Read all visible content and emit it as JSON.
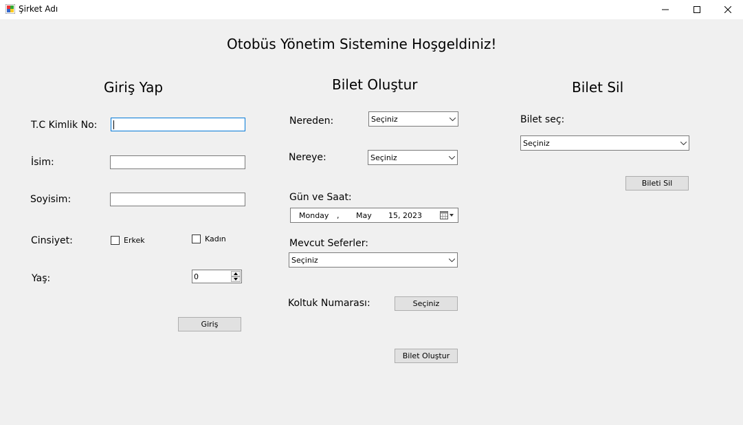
{
  "window": {
    "title": "Şirket Adı",
    "icons": [
      "app-icon",
      "minimize-icon",
      "maximize-icon",
      "close-icon"
    ]
  },
  "main_title": "Otobüs Yönetim Sistemine Hoşgeldiniz!",
  "login": {
    "heading": "Giriş Yap",
    "tc_label": "T.C Kimlik No:",
    "tc_value": "",
    "name_label": "İsim:",
    "name_value": "",
    "surname_label": "Soyisim:",
    "surname_value": "",
    "gender_label": "Cinsiyet:",
    "male_label": "Erkek",
    "female_label": "Kadın",
    "age_label": "Yaş:",
    "age_value": "0",
    "login_button": "Giriş"
  },
  "create_ticket": {
    "heading": "Bilet Oluştur",
    "from_label": "Nereden:",
    "from_value": "Seçiniz",
    "to_label": "Nereye:",
    "to_value": "Seçiniz",
    "datetime_label": "Gün ve Saat:",
    "date_weekday": "Monday",
    "date_sep": ",",
    "date_month": "May",
    "date_day_year": "15, 2023",
    "trips_label": "Mevcut Seferler:",
    "trips_value": "Seçiniz",
    "seat_label": "Koltuk Numarası:",
    "seat_button": "Seçiniz",
    "create_button": "Bilet Oluştur"
  },
  "delete_ticket": {
    "heading": "Bilet Sil",
    "select_label": "Bilet seç:",
    "select_value": "Seçiniz",
    "delete_button": "Bileti Sil"
  }
}
